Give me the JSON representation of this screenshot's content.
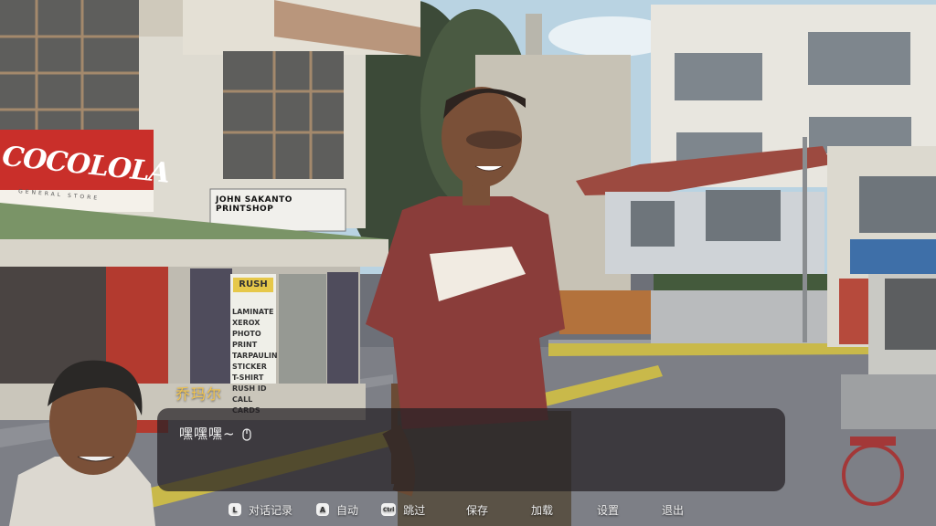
{
  "dialog": {
    "speaker": "乔玛尔",
    "text": "嘿嘿嘿~"
  },
  "scene": {
    "sign_coco": "COCOLOLA",
    "sign_coco_sub": "GENERAL STORE",
    "sign_print": "JOHN SAKANTO PRINTSHOP",
    "shop_rush": "RUSH",
    "shop_list": [
      "LAMINATE",
      "XEROX",
      "PHOTO PRINT",
      "TARPAULIN",
      "STICKER",
      "T-SHIRT",
      "RUSH ID",
      "CALL CARDS"
    ]
  },
  "menu": {
    "log": {
      "key": "L",
      "label": "对话记录"
    },
    "auto": {
      "key": "A",
      "label": "自动"
    },
    "skip": {
      "key": "Ctrl",
      "label": "跳过"
    },
    "save": "保存",
    "load": "加载",
    "settings": "设置",
    "exit": "退出"
  },
  "colors": {
    "speaker": "#f2c44e",
    "shirt": "#8a3d3a",
    "sky": "#b9d3e2"
  }
}
